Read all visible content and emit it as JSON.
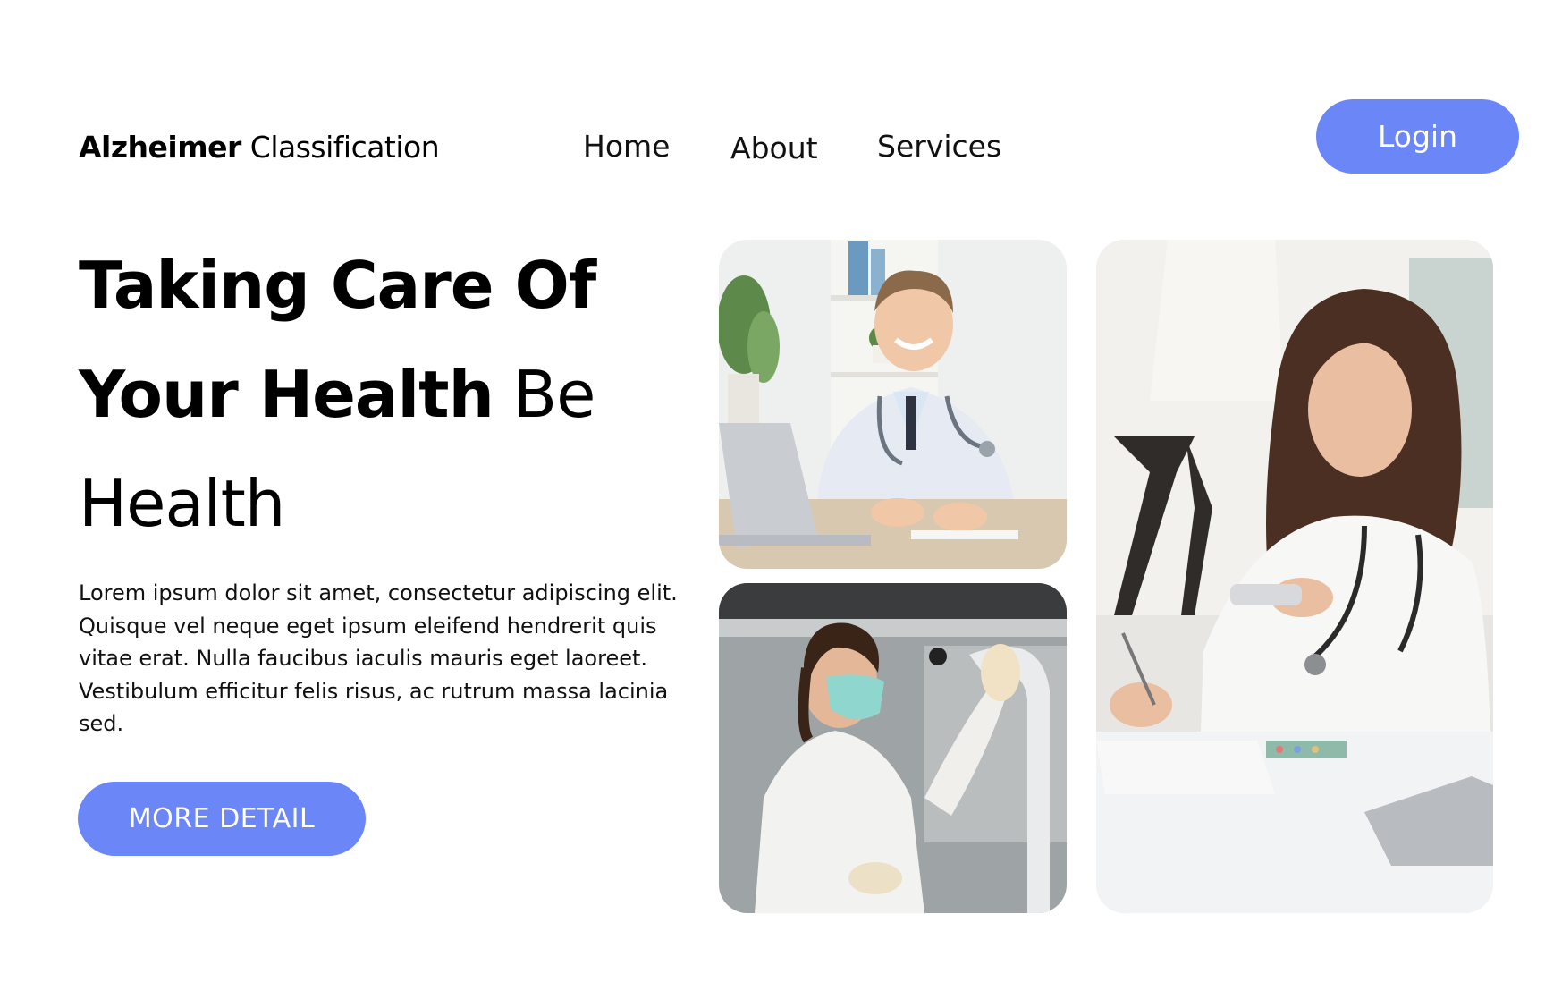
{
  "header": {
    "brand_strong": "Alzheimer",
    "brand_light": "Classification",
    "nav": {
      "home": "Home",
      "about": "About",
      "services": "Services"
    },
    "login_label": "Login"
  },
  "hero": {
    "title_line1": "Taking Care Of",
    "title_line2_bold": "Your Health",
    "title_line2_light": "Be",
    "title_line3": "Health",
    "description": "Lorem ipsum dolor sit amet, consectetur adipiscing elit. Quisque vel neque eget ipsum eleifend hendrerit quis vitae erat. Nulla faucibus iaculis mauris eget laoreet. Vestibulum efficitur felis risus, ac rutrum massa lacinia sed.",
    "cta_label": "MORE DETAIL"
  },
  "colors": {
    "accent": "#6b86f7",
    "text": "#000000",
    "background": "#ffffff"
  }
}
